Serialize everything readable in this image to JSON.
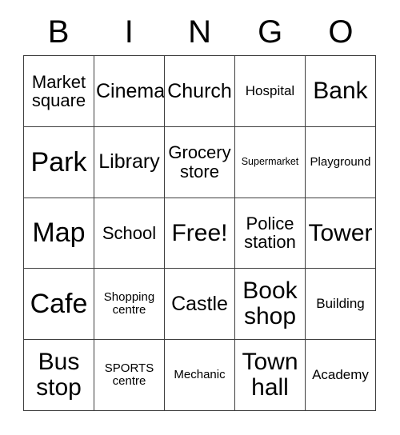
{
  "card": {
    "title": "BINGO",
    "header_letters": [
      "B",
      "I",
      "N",
      "G",
      "O"
    ],
    "free_space_label": "Free!",
    "colors": {
      "background": "#ffffff",
      "text": "#000000",
      "grid_line": "#3f3f3f"
    },
    "rows": [
      [
        {
          "label": "Market\nsquare",
          "size": "m"
        },
        {
          "label": "Cinema",
          "size": "l"
        },
        {
          "label": "Church",
          "size": "l"
        },
        {
          "label": "Hospital",
          "size": "s"
        },
        {
          "label": "Bank",
          "size": "xl"
        }
      ],
      [
        {
          "label": "Park",
          "size": "xxl"
        },
        {
          "label": "Library",
          "size": "l"
        },
        {
          "label": "Grocery\nstore",
          "size": "m"
        },
        {
          "label": "Supermarket",
          "size": "xxs"
        },
        {
          "label": "Playground",
          "size": "xs"
        }
      ],
      [
        {
          "label": "Map",
          "size": "xxl"
        },
        {
          "label": "School",
          "size": "m"
        },
        {
          "label": "Free!",
          "size": "xl"
        },
        {
          "label": "Police\nstation",
          "size": "m"
        },
        {
          "label": "Tower",
          "size": "xl"
        }
      ],
      [
        {
          "label": "Cafe",
          "size": "xxl"
        },
        {
          "label": "Shopping\ncentre",
          "size": "xs"
        },
        {
          "label": "Castle",
          "size": "l"
        },
        {
          "label": "Book\nshop",
          "size": "xl"
        },
        {
          "label": "Building",
          "size": "s"
        }
      ],
      [
        {
          "label": "Bus\nstop",
          "size": "xl"
        },
        {
          "label": "SPORTS\ncentre",
          "size": "xs"
        },
        {
          "label": "Mechanic",
          "size": "xs"
        },
        {
          "label": "Town\nhall",
          "size": "xl"
        },
        {
          "label": "Academy",
          "size": "s"
        }
      ]
    ]
  }
}
